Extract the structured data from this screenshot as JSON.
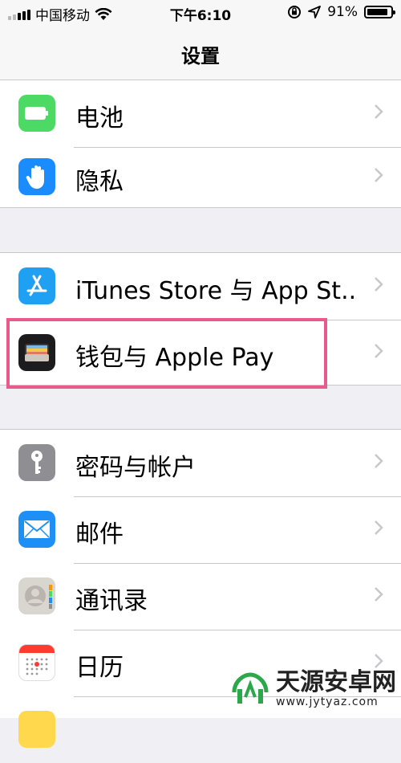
{
  "status_bar": {
    "carrier": "中国移动",
    "time": "下午6:10",
    "battery_percent": "91%",
    "battery_level": 0.91,
    "icons": [
      "signal-icon",
      "wifi-icon",
      "orientation-lock-icon",
      "location-icon",
      "battery-icon"
    ]
  },
  "nav": {
    "title": "设置"
  },
  "groups": [
    {
      "items": [
        {
          "label": "电池",
          "icon": "battery-app-icon",
          "color": "#4cd964"
        },
        {
          "label": "隐私",
          "icon": "privacy-hand-icon",
          "color": "#1a8cff"
        }
      ]
    },
    {
      "items": [
        {
          "label": "iTunes Store 与 App St...",
          "icon": "app-store-icon",
          "color": "#1fa0f2"
        },
        {
          "label": "钱包与 Apple Pay",
          "icon": "wallet-icon",
          "color": "#1c1c1e",
          "highlighted": true
        }
      ]
    },
    {
      "items": [
        {
          "label": "密码与帐户",
          "icon": "key-icon",
          "color": "#8e8e93"
        },
        {
          "label": "邮件",
          "icon": "mail-icon",
          "color": "#1e90f5"
        },
        {
          "label": "通讯录",
          "icon": "contacts-icon",
          "color": "#d9d5cf"
        },
        {
          "label": "日历",
          "icon": "calendar-icon",
          "color": "#ffffff"
        }
      ]
    }
  ],
  "watermark": {
    "name": "天源安卓网",
    "url": "www.jytyaz.com"
  },
  "colors": {
    "highlight": "#e85a8c",
    "background": "#efeff4",
    "separator": "#c8c7cc"
  }
}
